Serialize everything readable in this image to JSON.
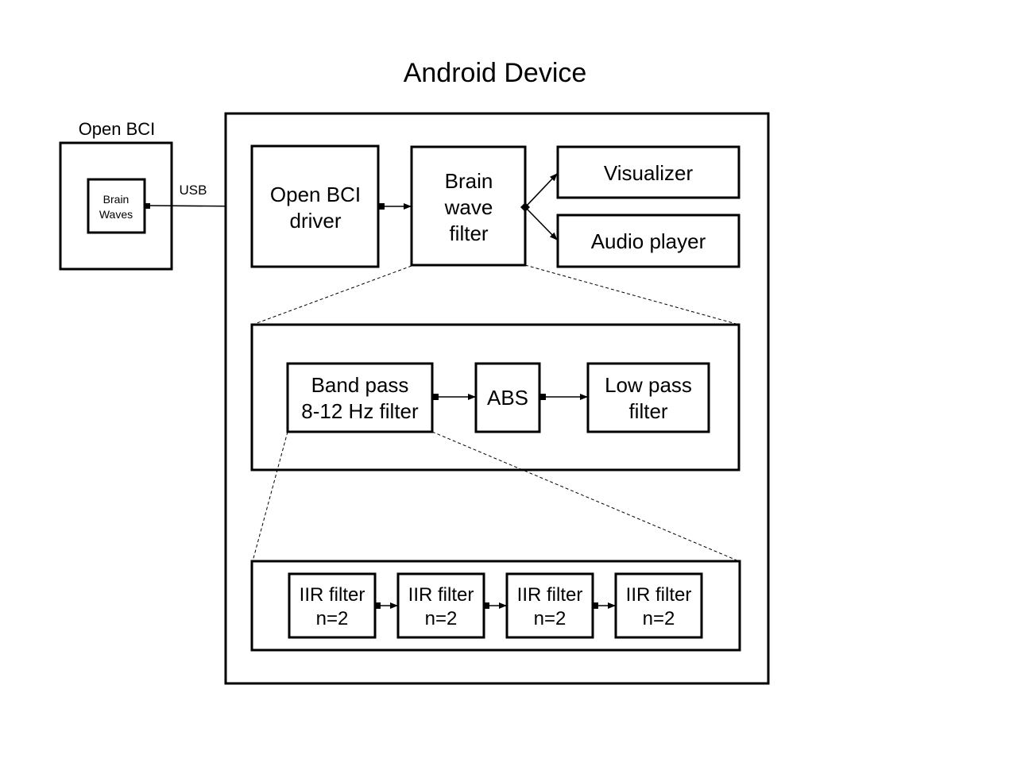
{
  "diagram": {
    "title": "Android Device",
    "openbci": {
      "label": "Open BCI",
      "inner_lines": [
        "Brain",
        "Waves"
      ]
    },
    "usb_label": "USB",
    "top_row": {
      "driver": [
        "Open BCI",
        "driver"
      ],
      "filter": [
        "Brain",
        "wave",
        "filter"
      ],
      "visualizer": "Visualizer",
      "audio": "Audio player"
    },
    "detail_row": {
      "bandpass": [
        "Band pass",
        "8-12 Hz filter"
      ],
      "abs": "ABS",
      "lowpass": [
        "Low pass",
        "filter"
      ]
    },
    "iir_row": [
      {
        "line1": "IIR filter",
        "line2": "n=2"
      },
      {
        "line1": "IIR filter",
        "line2": "n=2"
      },
      {
        "line1": "IIR filter",
        "line2": "n=2"
      },
      {
        "line1": "IIR filter",
        "line2": "n=2"
      }
    ]
  }
}
